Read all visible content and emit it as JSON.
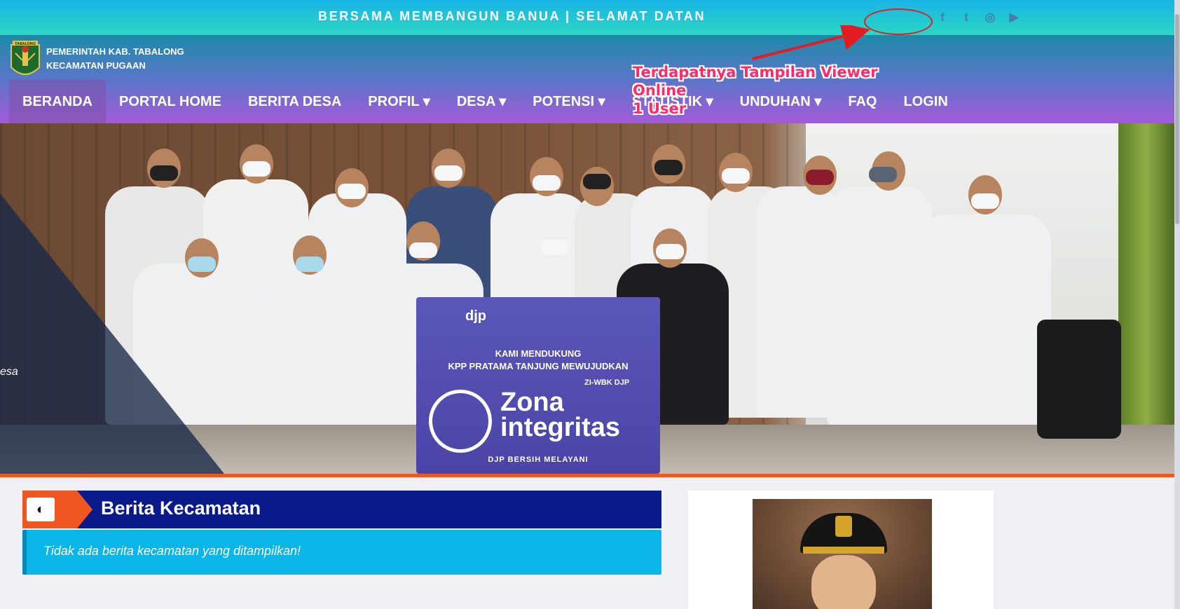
{
  "topbar": {
    "marquee": "BERSAMA MEMBANGUN BANUA | SELAMAT DATAN",
    "social": [
      {
        "icon": "facebook-icon",
        "glyph": "f"
      },
      {
        "icon": "twitter-icon",
        "glyph": "t"
      },
      {
        "icon": "instagram-icon",
        "glyph": "◎"
      },
      {
        "icon": "youtube-icon",
        "glyph": "▶"
      }
    ]
  },
  "header": {
    "logo_text": "TABALONG",
    "org_line1": "PEMERINTAH KAB. TABALONG",
    "org_line2": "KECAMATAN PUGAAN"
  },
  "nav": {
    "items": [
      {
        "label": "BERANDA",
        "active": true
      },
      {
        "label": "PORTAL HOME"
      },
      {
        "label": "BERITA DESA"
      },
      {
        "label": "PROFIL ▾"
      },
      {
        "label": "DESA ▾"
      },
      {
        "label": "POTENSI ▾"
      },
      {
        "label": "STATISTIK ▾"
      },
      {
        "label": "UNDUHAN ▾"
      },
      {
        "label": "FAQ"
      },
      {
        "label": "LOGIN"
      }
    ]
  },
  "hero": {
    "overlay_text": "esa",
    "banner": {
      "brand": "djp",
      "line1": "KAMI MENDUKUNG",
      "line2": "KPP PRATAMA TANJUNG MEWUJUDKAN",
      "tag": "ZI-WBK DJP",
      "zona1": "Zona",
      "zona2": "integritas",
      "footer": "DJP BERSIH MELAYANI"
    }
  },
  "annotation": {
    "line1": "Terdapatnya Tampilan Viewer",
    "line2": "Online",
    "line3": "1 User",
    "color": "#ff2a6a"
  },
  "news": {
    "title": "Berita Kecamatan",
    "empty_message": "Tidak ada berita kecamatan yang ditampilkan!"
  },
  "colors": {
    "accent_orange": "#f0561f",
    "news_header": "#0b1a8a",
    "news_empty": "#0ab6e8"
  }
}
